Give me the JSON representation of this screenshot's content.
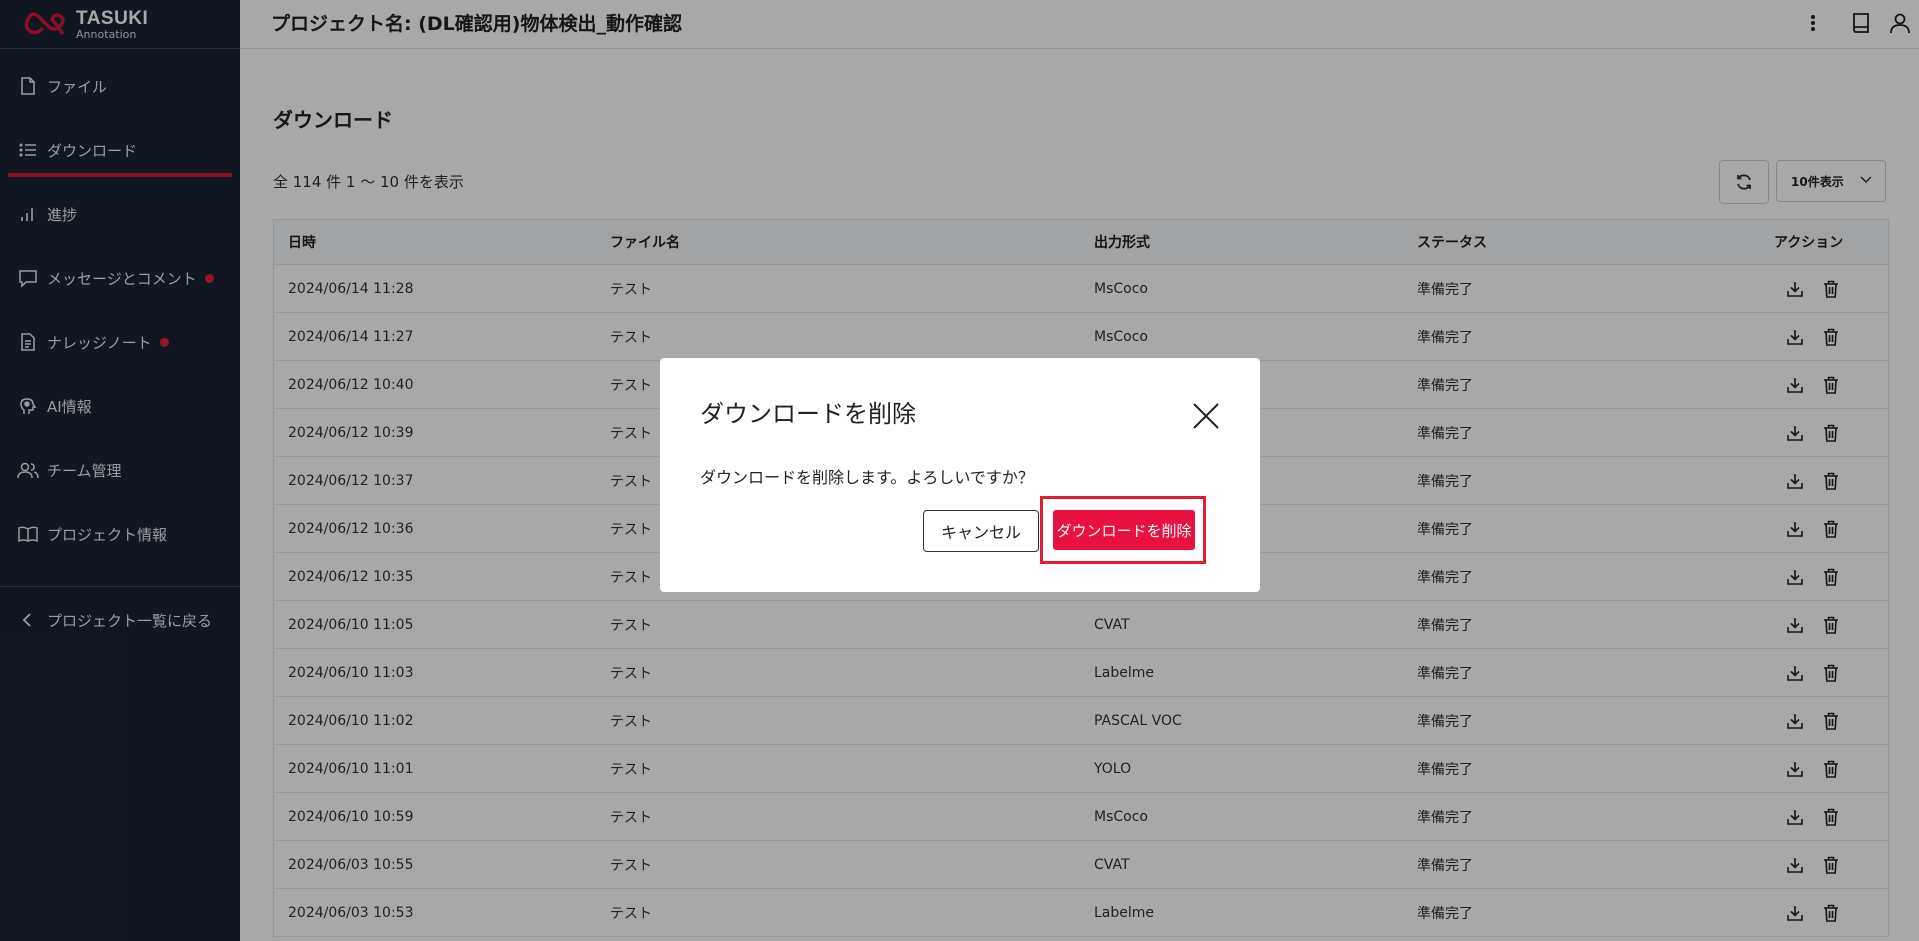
{
  "app": {
    "logo_title": "TASUKI",
    "logo_subtitle": "Annotation",
    "accent_color": "#d3173a"
  },
  "sidebar": {
    "items": [
      {
        "label": "ファイル",
        "icon": "file-icon"
      },
      {
        "label": "ダウンロード",
        "icon": "list-icon",
        "active": true
      },
      {
        "label": "進捗",
        "icon": "bar-chart-icon"
      },
      {
        "label": "メッセージとコメント",
        "icon": "message-icon",
        "badge": true
      },
      {
        "label": "ナレッジノート",
        "icon": "document-icon",
        "badge": true
      },
      {
        "label": "AI情報",
        "icon": "ai-head-icon"
      },
      {
        "label": "チーム管理",
        "icon": "users-icon"
      },
      {
        "label": "プロジェクト情報",
        "icon": "book-icon"
      }
    ],
    "back_label": "プロジェクト一覧に戻る"
  },
  "header": {
    "title": "プロジェクト名: (DL確認用)物体検出_動作確認"
  },
  "main": {
    "section_title": "ダウンロード",
    "count_text": "全 114 件 1 〜 10 件を表示",
    "per_page": "10件表示",
    "columns": [
      "日時",
      "ファイル名",
      "出力形式",
      "ステータス",
      "アクション"
    ],
    "rows": [
      {
        "date": "2024/06/14 11:28",
        "name": "テスト",
        "format": "MsCoco",
        "status": "準備完了"
      },
      {
        "date": "2024/06/14 11:27",
        "name": "テスト",
        "format": "MsCoco",
        "status": "準備完了"
      },
      {
        "date": "2024/06/12 10:40",
        "name": "テスト",
        "format": "",
        "status": "準備完了"
      },
      {
        "date": "2024/06/12 10:39",
        "name": "テスト",
        "format": "",
        "status": "準備完了"
      },
      {
        "date": "2024/06/12 10:37",
        "name": "テスト",
        "format": "",
        "status": "準備完了"
      },
      {
        "date": "2024/06/12 10:36",
        "name": "テスト",
        "format": "",
        "status": "準備完了"
      },
      {
        "date": "2024/06/12 10:35",
        "name": "テスト",
        "format": "",
        "status": "準備完了"
      },
      {
        "date": "2024/06/10 11:05",
        "name": "テスト",
        "format": "CVAT",
        "status": "準備完了"
      },
      {
        "date": "2024/06/10 11:03",
        "name": "テスト",
        "format": "Labelme",
        "status": "準備完了"
      },
      {
        "date": "2024/06/10 11:02",
        "name": "テスト",
        "format": "PASCAL VOC",
        "status": "準備完了"
      },
      {
        "date": "2024/06/10 11:01",
        "name": "テスト",
        "format": "YOLO",
        "status": "準備完了"
      },
      {
        "date": "2024/06/10 10:59",
        "name": "テスト",
        "format": "MsCoco",
        "status": "準備完了"
      },
      {
        "date": "2024/06/03 10:55",
        "name": "テスト",
        "format": "CVAT",
        "status": "準備完了"
      },
      {
        "date": "2024/06/03 10:53",
        "name": "テスト",
        "format": "Labelme",
        "status": "準備完了"
      }
    ]
  },
  "modal": {
    "title": "ダウンロードを削除",
    "message": "ダウンロードを削除します。よろしいですか？",
    "cancel_label": "キャンセル",
    "confirm_label": "ダウンロードを削除",
    "confirm_color": "#e8113f",
    "highlight_color": "#e11d35"
  }
}
